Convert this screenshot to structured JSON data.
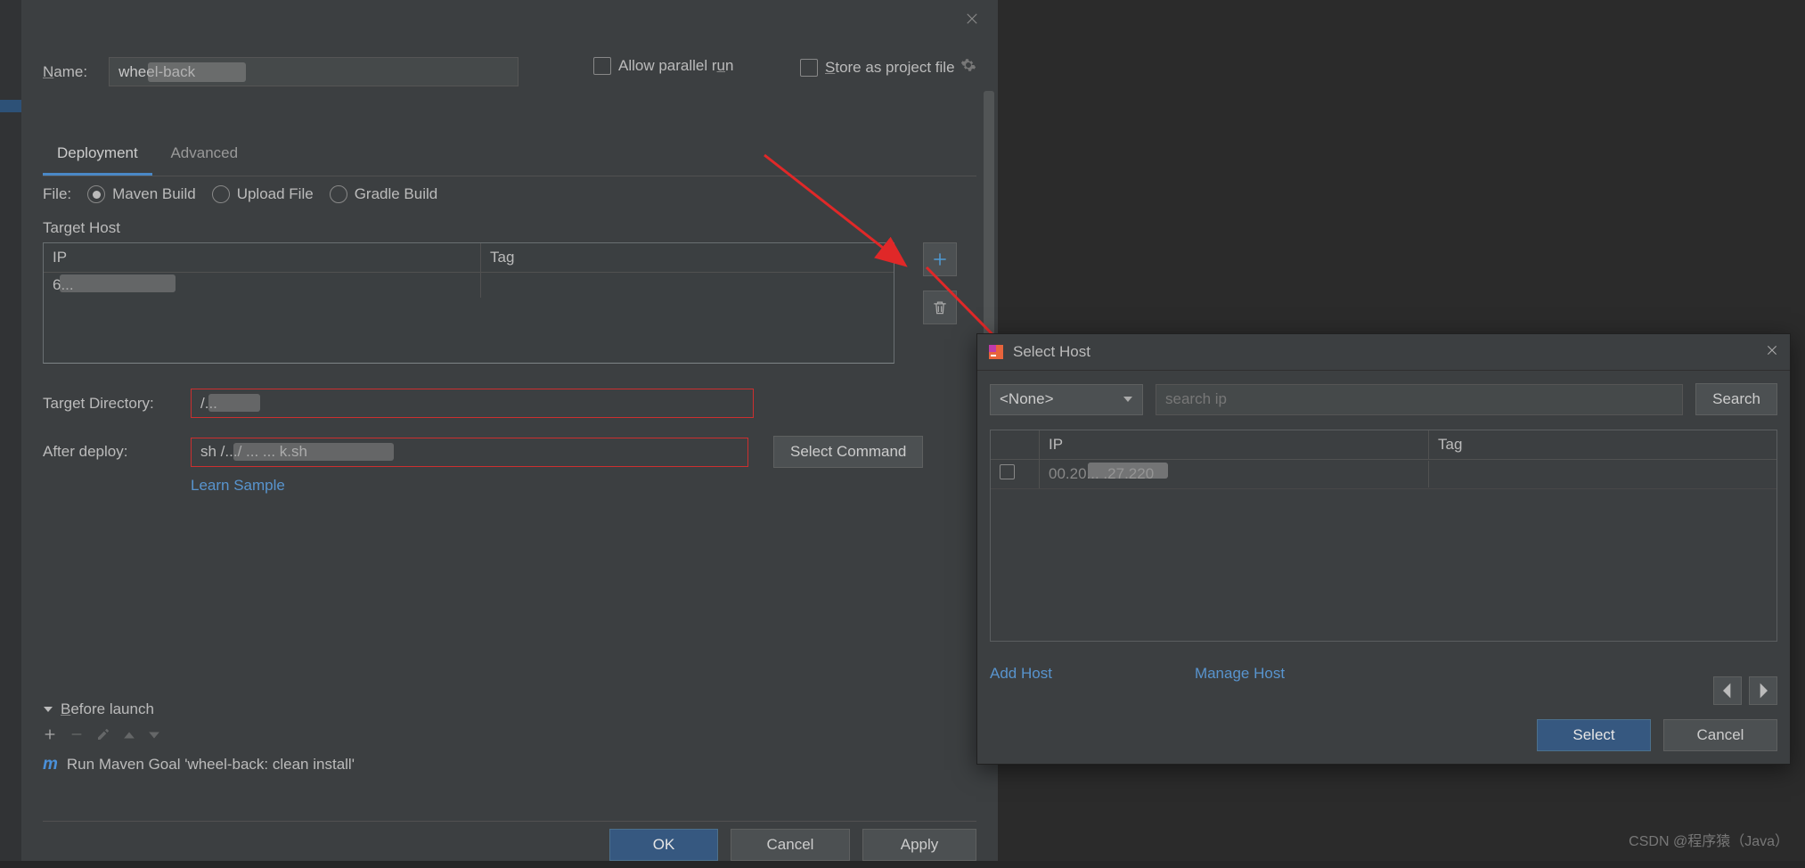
{
  "dialog": {
    "name_label": "Name:",
    "name_value": "wheel-back",
    "allow_parallel_run": "Allow parallel run",
    "store_as_project_file": "Store as project file",
    "tabs": {
      "deployment": "Deployment",
      "advanced": "Advanced"
    },
    "file_label": "File:",
    "file_options": {
      "maven": "Maven Build",
      "upload": "Upload File",
      "gradle": "Gradle Build"
    },
    "target_host_label": "Target Host",
    "host_table": {
      "col_ip": "IP",
      "col_tag": "Tag",
      "row_ip": "6..."
    },
    "target_dir_label": "Target Directory:",
    "target_dir_value": "/...",
    "after_deploy_label": "After deploy:",
    "after_deploy_value": "sh /.../ ... ... k.sh",
    "select_command_btn": "Select Command",
    "learn_sample": "Learn Sample",
    "before_launch_label": "Before launch",
    "goal_text": "Run Maven Goal 'wheel-back: clean install'",
    "bottom": {
      "ok": "OK",
      "cancel": "Cancel",
      "apply": "Apply"
    }
  },
  "popup": {
    "title": "Select Host",
    "filter_select": "<None>",
    "search_placeholder": "search ip",
    "search_btn": "Search",
    "col_ip": "IP",
    "col_tag": "Tag",
    "row_ip": "00.20... .27.220",
    "add_host": "Add Host",
    "manage_host": "Manage Host",
    "select_btn": "Select",
    "cancel_btn": "Cancel"
  },
  "watermark": "CSDN @程序猿（Java）"
}
